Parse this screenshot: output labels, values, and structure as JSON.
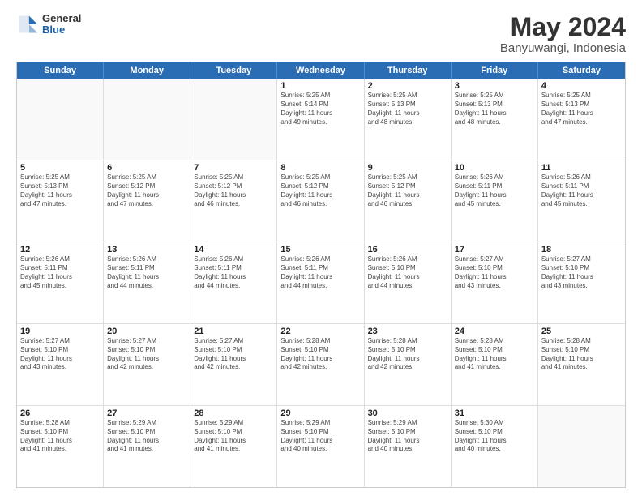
{
  "header": {
    "logo": {
      "general": "General",
      "blue": "Blue"
    },
    "title": "May 2024",
    "location": "Banyuwangi, Indonesia"
  },
  "calendar": {
    "days": [
      "Sunday",
      "Monday",
      "Tuesday",
      "Wednesday",
      "Thursday",
      "Friday",
      "Saturday"
    ],
    "rows": [
      [
        {
          "day": "",
          "info": ""
        },
        {
          "day": "",
          "info": ""
        },
        {
          "day": "",
          "info": ""
        },
        {
          "day": "1",
          "info": "Sunrise: 5:25 AM\nSunset: 5:14 PM\nDaylight: 11 hours\nand 49 minutes."
        },
        {
          "day": "2",
          "info": "Sunrise: 5:25 AM\nSunset: 5:13 PM\nDaylight: 11 hours\nand 48 minutes."
        },
        {
          "day": "3",
          "info": "Sunrise: 5:25 AM\nSunset: 5:13 PM\nDaylight: 11 hours\nand 48 minutes."
        },
        {
          "day": "4",
          "info": "Sunrise: 5:25 AM\nSunset: 5:13 PM\nDaylight: 11 hours\nand 47 minutes."
        }
      ],
      [
        {
          "day": "5",
          "info": "Sunrise: 5:25 AM\nSunset: 5:13 PM\nDaylight: 11 hours\nand 47 minutes."
        },
        {
          "day": "6",
          "info": "Sunrise: 5:25 AM\nSunset: 5:12 PM\nDaylight: 11 hours\nand 47 minutes."
        },
        {
          "day": "7",
          "info": "Sunrise: 5:25 AM\nSunset: 5:12 PM\nDaylight: 11 hours\nand 46 minutes."
        },
        {
          "day": "8",
          "info": "Sunrise: 5:25 AM\nSunset: 5:12 PM\nDaylight: 11 hours\nand 46 minutes."
        },
        {
          "day": "9",
          "info": "Sunrise: 5:25 AM\nSunset: 5:12 PM\nDaylight: 11 hours\nand 46 minutes."
        },
        {
          "day": "10",
          "info": "Sunrise: 5:26 AM\nSunset: 5:11 PM\nDaylight: 11 hours\nand 45 minutes."
        },
        {
          "day": "11",
          "info": "Sunrise: 5:26 AM\nSunset: 5:11 PM\nDaylight: 11 hours\nand 45 minutes."
        }
      ],
      [
        {
          "day": "12",
          "info": "Sunrise: 5:26 AM\nSunset: 5:11 PM\nDaylight: 11 hours\nand 45 minutes."
        },
        {
          "day": "13",
          "info": "Sunrise: 5:26 AM\nSunset: 5:11 PM\nDaylight: 11 hours\nand 44 minutes."
        },
        {
          "day": "14",
          "info": "Sunrise: 5:26 AM\nSunset: 5:11 PM\nDaylight: 11 hours\nand 44 minutes."
        },
        {
          "day": "15",
          "info": "Sunrise: 5:26 AM\nSunset: 5:11 PM\nDaylight: 11 hours\nand 44 minutes."
        },
        {
          "day": "16",
          "info": "Sunrise: 5:26 AM\nSunset: 5:10 PM\nDaylight: 11 hours\nand 44 minutes."
        },
        {
          "day": "17",
          "info": "Sunrise: 5:27 AM\nSunset: 5:10 PM\nDaylight: 11 hours\nand 43 minutes."
        },
        {
          "day": "18",
          "info": "Sunrise: 5:27 AM\nSunset: 5:10 PM\nDaylight: 11 hours\nand 43 minutes."
        }
      ],
      [
        {
          "day": "19",
          "info": "Sunrise: 5:27 AM\nSunset: 5:10 PM\nDaylight: 11 hours\nand 43 minutes."
        },
        {
          "day": "20",
          "info": "Sunrise: 5:27 AM\nSunset: 5:10 PM\nDaylight: 11 hours\nand 42 minutes."
        },
        {
          "day": "21",
          "info": "Sunrise: 5:27 AM\nSunset: 5:10 PM\nDaylight: 11 hours\nand 42 minutes."
        },
        {
          "day": "22",
          "info": "Sunrise: 5:28 AM\nSunset: 5:10 PM\nDaylight: 11 hours\nand 42 minutes."
        },
        {
          "day": "23",
          "info": "Sunrise: 5:28 AM\nSunset: 5:10 PM\nDaylight: 11 hours\nand 42 minutes."
        },
        {
          "day": "24",
          "info": "Sunrise: 5:28 AM\nSunset: 5:10 PM\nDaylight: 11 hours\nand 41 minutes."
        },
        {
          "day": "25",
          "info": "Sunrise: 5:28 AM\nSunset: 5:10 PM\nDaylight: 11 hours\nand 41 minutes."
        }
      ],
      [
        {
          "day": "26",
          "info": "Sunrise: 5:28 AM\nSunset: 5:10 PM\nDaylight: 11 hours\nand 41 minutes."
        },
        {
          "day": "27",
          "info": "Sunrise: 5:29 AM\nSunset: 5:10 PM\nDaylight: 11 hours\nand 41 minutes."
        },
        {
          "day": "28",
          "info": "Sunrise: 5:29 AM\nSunset: 5:10 PM\nDaylight: 11 hours\nand 41 minutes."
        },
        {
          "day": "29",
          "info": "Sunrise: 5:29 AM\nSunset: 5:10 PM\nDaylight: 11 hours\nand 40 minutes."
        },
        {
          "day": "30",
          "info": "Sunrise: 5:29 AM\nSunset: 5:10 PM\nDaylight: 11 hours\nand 40 minutes."
        },
        {
          "day": "31",
          "info": "Sunrise: 5:30 AM\nSunset: 5:10 PM\nDaylight: 11 hours\nand 40 minutes."
        },
        {
          "day": "",
          "info": ""
        }
      ]
    ]
  }
}
